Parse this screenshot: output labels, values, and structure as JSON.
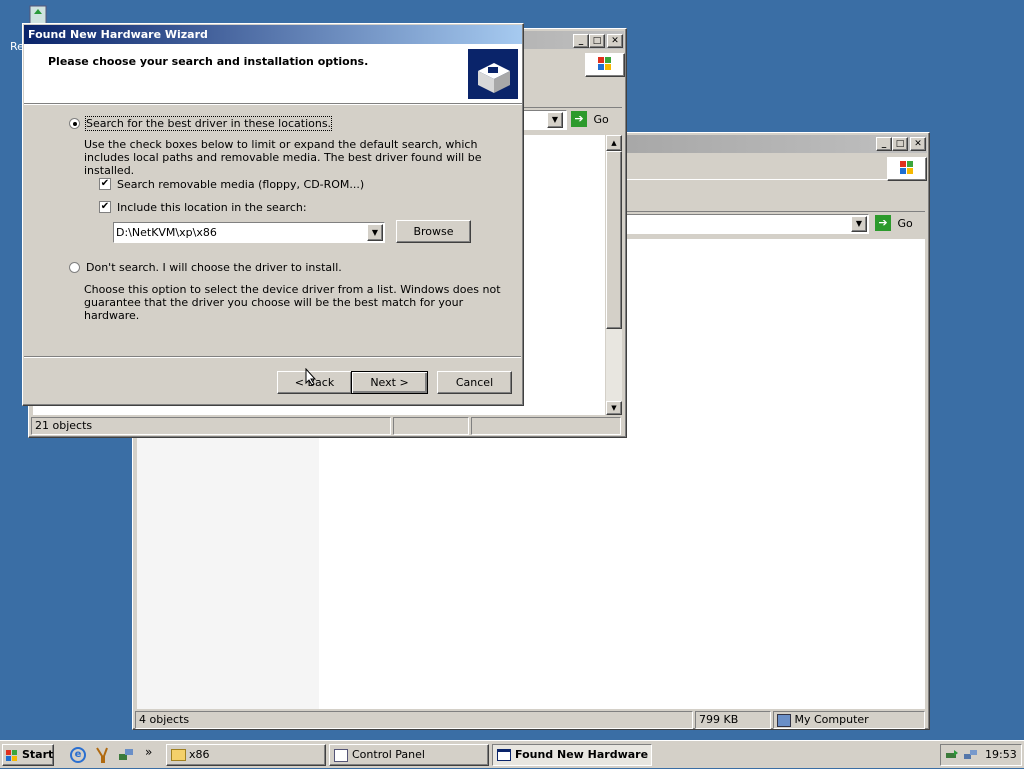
{
  "wizard": {
    "title": "Found New Hardware Wizard",
    "header": "Please choose your search and installation options.",
    "radio_search": "Search for the best driver in these locations.",
    "search_desc": "Use the check boxes below to limit or expand the default search, which includes local paths and removable media. The best driver found will be installed.",
    "check_removable": "Search removable media (floppy, CD-ROM...)",
    "check_location": "Include this location in the search:",
    "location_value": "D:\\NetKVM\\xp\\x86",
    "browse": "Browse",
    "radio_dont_search": "Don't search. I will choose the driver to install.",
    "dont_search_desc": "Choose this option to select the device driver from a list.  Windows does not guarantee that the driver you choose will be the best match for your hardware.",
    "back": "< Back",
    "next": "Next >",
    "cancel": "Cancel"
  },
  "window_back": {
    "go": "Go",
    "status_objects": "21 objects"
  },
  "window_front": {
    "go": "Go",
    "status_objects": "4 objects",
    "status_size": "799 KB",
    "status_location": "My Computer"
  },
  "desktop": {
    "recycle_label": "Re"
  },
  "taskbar": {
    "start": "Start",
    "more": "»",
    "tasks": [
      "x86",
      "Control Panel",
      "Found New Hardware ..."
    ],
    "time": "19:53"
  }
}
